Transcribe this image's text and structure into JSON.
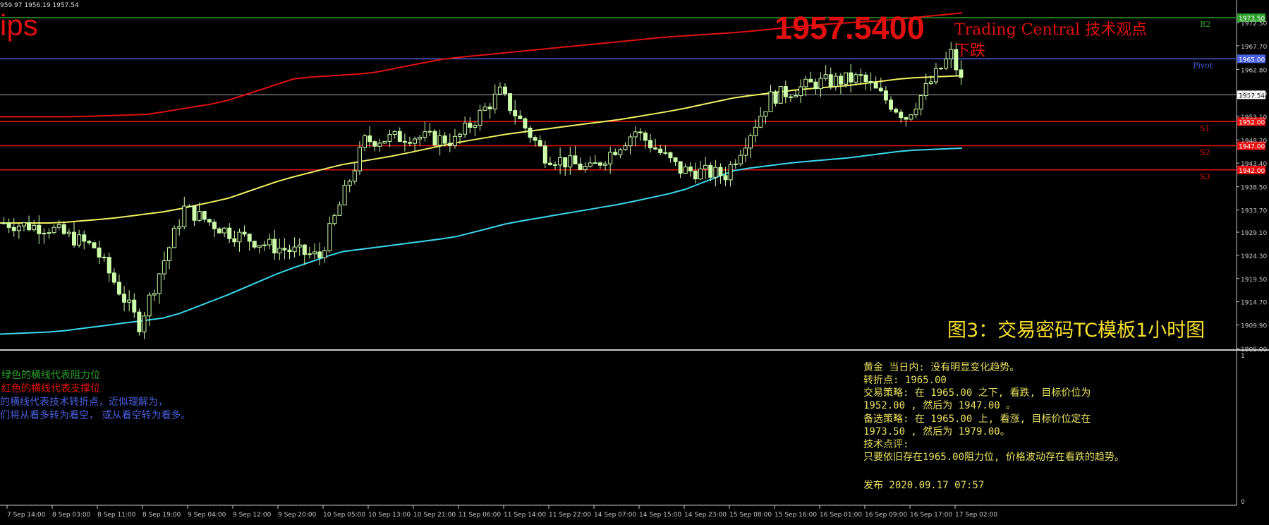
{
  "header": {
    "ohlc_text": "959.97 1956.19 1957.54",
    "symbol_fragment": "ips",
    "big_price": "1957.5400",
    "tc_title": "Trading Central 技术观点",
    "tc_direction": "下跌",
    "figure_caption": "图3：交易密码TC模板1小时图"
  },
  "colors": {
    "background": "#000000",
    "candle": "#ccffaa",
    "upper_band": "#e01010",
    "lower_band": "#39d8f0",
    "middle_ma": "#f2f060",
    "resistance": "#2ca02c",
    "pivot": "#4a60e0",
    "support": "#e81010",
    "current_price_line": "#aaaaaa",
    "axis": "#c8c8c8",
    "note_yellow": "#e8e060"
  },
  "levels": {
    "r2": {
      "label": "R2",
      "price": 1973.5,
      "tag": "1973.50"
    },
    "pivot": {
      "label": "Pivot",
      "price": 1965.0,
      "tag": "1965.00"
    },
    "current": {
      "price": 1957.54,
      "tag": "1957.54"
    },
    "s1": {
      "label": "S1",
      "price": 1952.0,
      "tag": "1952.00"
    },
    "s2": {
      "label": "S2",
      "price": 1947.0,
      "tag": "1947.00"
    },
    "s3": {
      "label": "S3",
      "price": 1942.0,
      "tag": "1942.00"
    }
  },
  "price_axis": {
    "ticks": [
      "1972.50",
      "1967.70",
      "1962.80",
      "1957.90",
      "1953.10",
      "1948.20",
      "1943.40",
      "1938.50",
      "1933.70",
      "1929.10",
      "1924.30",
      "1919.50",
      "1914.70",
      "1909.90",
      "1905.00"
    ]
  },
  "time_axis": {
    "ticks": [
      "7 Sep 14:00",
      "8 Sep 03:00",
      "8 Sep 11:00",
      "8 Sep 19:00",
      "9 Sep 04:00",
      "9 Sep 12:00",
      "9 Sep 20:00",
      "10 Sep 05:00",
      "10 Sep 13:00",
      "10 Sep 21:00",
      "11 Sep 06:00",
      "11 Sep 14:00",
      "11 Sep 22:00",
      "14 Sep 07:00",
      "14 Sep 15:00",
      "14 Sep 23:00",
      "15 Sep 08:00",
      "15 Sep 16:00",
      "16 Sep 01:00",
      "16 Sep 09:00",
      "16 Sep 17:00",
      "17 Sep 02:00"
    ]
  },
  "sub_panel": {
    "axis_top": "1",
    "axis_bottom": "0"
  },
  "legend_left": {
    "line1": "绿色的横线代表阻力位",
    "line2": "红色的横线代表支撑位",
    "line3": "的横线代表技术转折点，近似理解为，",
    "line4": "们将从看多转为看空，  或从看空转为看多。"
  },
  "analysis": {
    "line1": "黄金 当日内: 没有明显变化趋势。",
    "line2": "转折点: 1965.00",
    "line3": "交易策略: 在 1965.00 之下, 看跌, 目标价位为",
    "line4": "1952.00 , 然后为 1947.00 。",
    "line5": "备选策略: 在 1965.00  上, 看涨, 目标价位定在",
    "line6": "1973.50 , 然后为 1979.00。",
    "line7": "技术点评:",
    "line8": "只要依旧存在1965.00阻力位, 价格波动存在看跌的趋势。",
    "line9": "发布 2020.09.17 07:57"
  },
  "chart_data": {
    "type": "candlestick",
    "price_range": [
      1905.0,
      1974.5
    ],
    "anchors_x": [
      0,
      9,
      18,
      27,
      36,
      45,
      54,
      63,
      72,
      81,
      90,
      99,
      108,
      117,
      126,
      135,
      144,
      153,
      162,
      171,
      180,
      189,
      192
    ],
    "close_anchors": [
      1931.0,
      1930.0,
      1926.0,
      1910.0,
      1934.0,
      1929.0,
      1926.0,
      1924.0,
      1948.0,
      1949.0,
      1948.0,
      1958.0,
      1945.0,
      1942.0,
      1950.0,
      1942.0,
      1941.0,
      1957.0,
      1960.0,
      1961.0,
      1953.0,
      1966.0,
      1957.54
    ],
    "middle_ma": [
      1931.0,
      1931.0,
      1932.0,
      1933.5,
      1936.0,
      1940.0,
      1943.0,
      1945.0,
      1947.5,
      1949.5,
      1951.0,
      1952.5,
      1954.5,
      1957.0,
      1958.5,
      1959.5,
      1961.0,
      1961.5
    ],
    "upper_band": [
      1953.0,
      1953.0,
      1953.5,
      1956.0,
      1961.0,
      1962.0,
      1965.0,
      1966.5,
      1968.0,
      1969.5,
      1970.5,
      1972.0,
      1973.0,
      1974.5
    ],
    "lower_band": [
      1908.0,
      1908.5,
      1910.0,
      1911.5,
      1916.0,
      1921.0,
      1925.0,
      1926.5,
      1928.0,
      1931.0,
      1933.0,
      1935.0,
      1937.5,
      1942.0,
      1943.5,
      1944.5,
      1946.0,
      1946.5
    ]
  }
}
